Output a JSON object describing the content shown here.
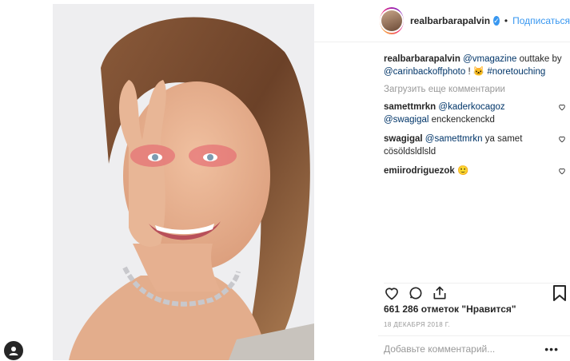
{
  "post": {
    "username": "realbarbarapalvin",
    "verified_icon": "verified-badge-icon",
    "separator": "•",
    "follow_label": "Подписаться",
    "caption": {
      "username": "realbarbarapalvin",
      "mention1": "@vmagazine",
      "text1": " outtake by ",
      "mention2": "@carinbackoffphoto",
      "text2": " ! 🐱 ",
      "hashtag": "#noretouching"
    },
    "load_more_label": "Загрузить еще комментарии",
    "comments": [
      {
        "username": "samettmrkn",
        "mention1": "@kaderkocagoz",
        "mention2": "@swagigal",
        "text": "enckenckenckd"
      },
      {
        "username": "swagigal",
        "mention": "@samettmrkn",
        "text": " ya samet cösöldsldlsld"
      },
      {
        "username": "emiirodriguezok",
        "text": " 🙂"
      }
    ],
    "likes": "661 286 отметок \"Нравится\"",
    "date": "18 ДЕКАБРЯ 2018 Г.",
    "add_comment_placeholder": "Добавьте комментарий...",
    "more_label": "•••"
  },
  "colors": {
    "link": "#3897f0",
    "mention": "#003569",
    "muted": "#999999",
    "text": "#262626"
  }
}
